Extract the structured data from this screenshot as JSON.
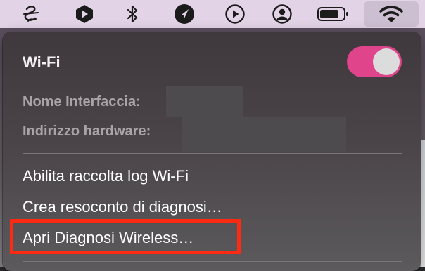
{
  "menubar": {
    "icons": [
      "scribble-app-icon",
      "arrow-app-icon",
      "bluetooth-icon",
      "location-arrow-icon",
      "play-circle-icon",
      "user-circle-icon",
      "battery-icon",
      "wifi-icon"
    ]
  },
  "panel": {
    "title": "Wi-Fi",
    "toggle_on": true,
    "interface_label": "Nome Interfaccia:",
    "hardware_label": "Indirizzo hardware:",
    "items": [
      {
        "label": "Abilita raccolta log Wi-Fi"
      },
      {
        "label": "Crea resoconto di diagnosi…"
      },
      {
        "label": "Apri Diagnosi Wireless…"
      }
    ]
  },
  "colors": {
    "toggle_accent": "#e0448b",
    "highlight_border": "#ff2a12",
    "menubar_bg": "#e2d3e6"
  }
}
